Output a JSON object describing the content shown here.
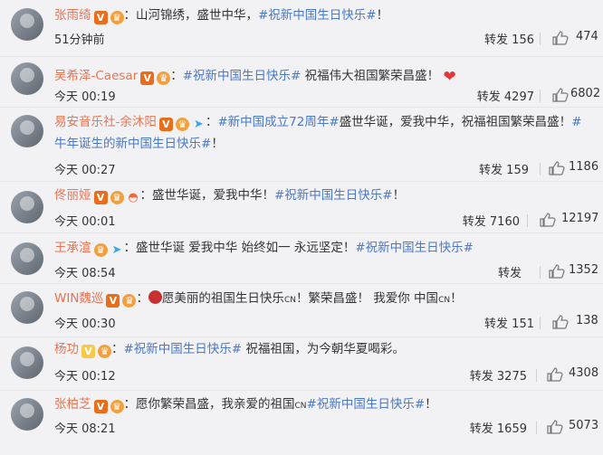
{
  "comments": [
    {
      "name": "张雨绮",
      "badges": [
        "V",
        "crown"
      ],
      "text": "：山河锦绣，盛世中华，",
      "tag": "#祝新中国生日快乐#",
      "tail": "！",
      "time": "51分钟前",
      "repost_label": "转发",
      "reposts": "156",
      "likes": "474"
    },
    {
      "name": "吴希泽-Caesar",
      "badges": [
        "V",
        "crown"
      ],
      "text": "：",
      "tag": "#祝新中国生日快乐#",
      "tail": " 祝福伟大祖国繁荣昌盛！",
      "heart": "❤",
      "time": "今天 00:19",
      "repost_label": "转发",
      "reposts": "4297",
      "likes": "6802"
    },
    {
      "name": "易安音乐社-余沐阳",
      "badges": [
        "V",
        "crown",
        "plane"
      ],
      "text": "：",
      "tag": "#新中国成立72周年#",
      "tail": "盛世华诞，爱我中华，祝福祖国繁荣昌盛！",
      "tag2": "#牛年诞生的新中国生日快乐#",
      "tail2": "！",
      "time": "今天 00:27",
      "repost_label": "转发",
      "reposts": "159",
      "likes": "1186"
    },
    {
      "name": "佟丽娅",
      "badges": [
        "V",
        "crown",
        "rainbow"
      ],
      "text": "：盛世华诞，爱我中华！",
      "tag": "#祝新中国生日快乐#",
      "tail": "！",
      "time": "今天 00:01",
      "repost_label": "转发",
      "reposts": "7160",
      "likes": "12197"
    },
    {
      "name": "王承渲",
      "badges": [
        "crown",
        "plane"
      ],
      "text": "：盛世华诞 爱我中华 始终如一 永远坚定！",
      "tag": "#祝新中国生日快乐#",
      "tail": "",
      "time": "今天 08:54",
      "repost_label": "转发",
      "reposts": "",
      "likes": "1352"
    },
    {
      "name": "WIN魏巡",
      "badges": [
        "V",
        "crown"
      ],
      "text": "：",
      "emoji_text": "愿美丽的祖国生日快乐",
      "cn1": "CN",
      "tail": "！繁荣昌盛！ 我爱你 中国",
      "cn2": "CN",
      "tail2": "！",
      "time": "今天 00:30",
      "repost_label": "转发",
      "reposts": "151",
      "likes": "138"
    },
    {
      "name": "杨功",
      "badges": [
        "Vy",
        "crown"
      ],
      "text": "：",
      "tag": "#祝新中国生日快乐#",
      "tail": " 祝福祖国，为今朝华夏喝彩。",
      "time": "今天 00:12",
      "repost_label": "转发",
      "reposts": "3275",
      "likes": "4308"
    },
    {
      "name": "张柏芝",
      "badges": [
        "V",
        "crown"
      ],
      "text": "：愿你繁荣昌盛，我亲爱的祖国",
      "cn1": "CN",
      "tag": "#祝新中国生日快乐#",
      "tail": "！",
      "time": "今天 08:21",
      "repost_label": "转发",
      "reposts": "1659",
      "likes": "5073"
    }
  ],
  "colors": {
    "name": "#eb7350",
    "tag": "#4a78c7",
    "bg": "#f2f2f5"
  }
}
